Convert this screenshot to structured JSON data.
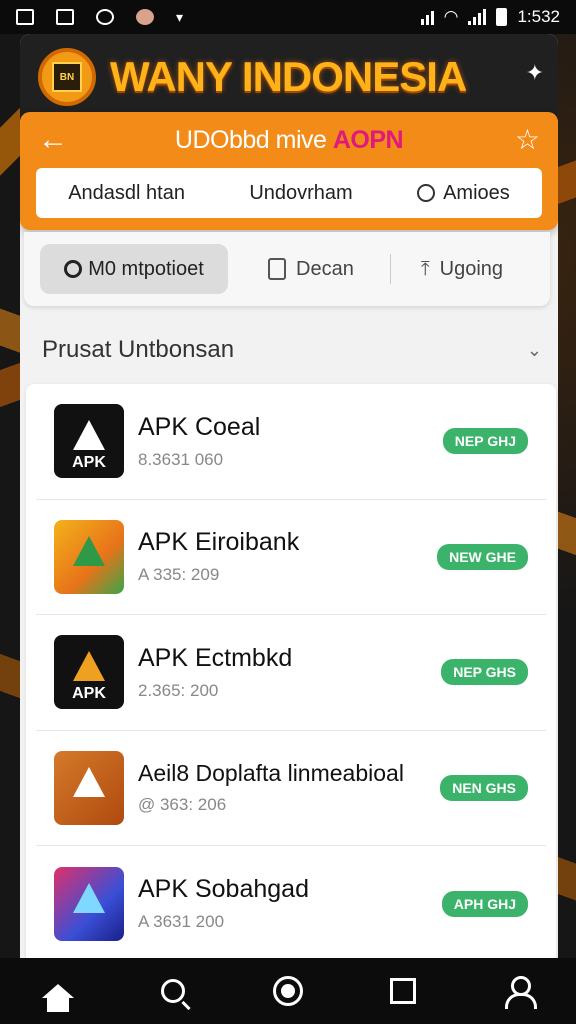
{
  "status_bar": {
    "time": "1:532",
    "left_icons": [
      "notification-icon",
      "image-icon",
      "sync-icon",
      "avatar-icon",
      "bird-icon"
    ],
    "right_icons": [
      "signal-icon",
      "wifi-icon",
      "cell-signal-icon",
      "battery-icon"
    ]
  },
  "banner": {
    "title": "WANY INDONESIA",
    "logo_text": "BN"
  },
  "header": {
    "title_main": "UDObbd mive ",
    "title_highlight": "AOPN",
    "nav": [
      {
        "label": "Andasdl htan"
      },
      {
        "label": "Undovrham"
      },
      {
        "label": "Amioes",
        "icon": "search-icon"
      }
    ]
  },
  "filters": {
    "chip_label": "M0 mtpotioet",
    "item1_label": "Decan",
    "item2_label": "Ugoing"
  },
  "section": {
    "title": "Prusat Untbonsan"
  },
  "apps": [
    {
      "name": "APK Coeal",
      "meta": "8.3631 060",
      "badge": "NEP GHJ",
      "icon_label": "APK",
      "icon_color": "#111111"
    },
    {
      "name": "APK Eiroibank",
      "meta": "A 335: 209",
      "badge": "NEW GHE",
      "icon_label": "",
      "icon_color": "#f3b21b"
    },
    {
      "name": "APK Ectmbkd",
      "meta": "2.365: 200",
      "badge": "NEP GHS",
      "icon_label": "APK",
      "icon_color": "#111111"
    },
    {
      "name": "Aeil8 Doplafta linmeabioal",
      "meta": "@ 363: 206",
      "badge": "NEN GHS",
      "icon_label": "",
      "icon_color": "#c8621d"
    },
    {
      "name": "APK Sobahgad",
      "meta": "A 3631 200",
      "badge": "APH GHJ",
      "icon_label": "",
      "icon_color": "#5a3db8"
    }
  ],
  "bottom_nav": [
    "home-icon",
    "search-icon",
    "circle-icon",
    "square-icon",
    "user-icon"
  ],
  "colors": {
    "accent": "#f28b18",
    "badge": "#3bb36a",
    "highlight": "#e0197d"
  }
}
